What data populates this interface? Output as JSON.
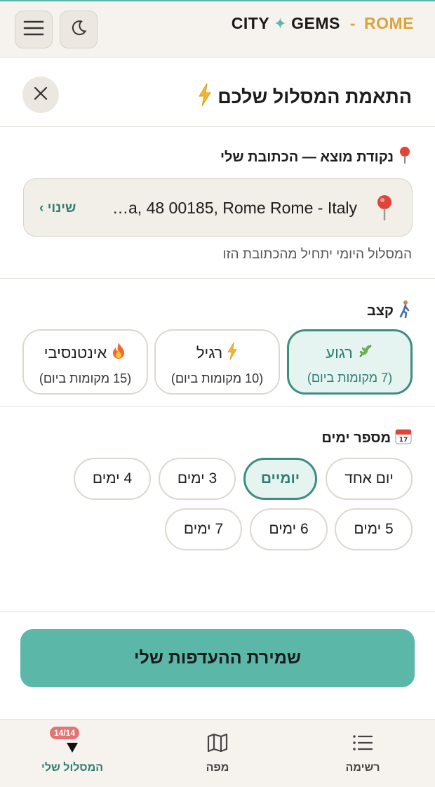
{
  "brand": {
    "part1": "CITY",
    "part2": "GEMS",
    "dash": "-",
    "city": "ROME"
  },
  "header": {
    "title": "התאמת המסלול שלכם"
  },
  "origin": {
    "label": "נקודת מוצא — הכתובת שלי",
    "address": "…a, 48 00185, Rome Rome - Italy",
    "change": "שינוי ›",
    "hint": "המסלול היומי יתחיל מהכתובת הזו"
  },
  "pace": {
    "label": "קצב",
    "options": [
      {
        "title": "רגוע",
        "sub": "(7 מקומות ביום)",
        "selected": true
      },
      {
        "title": "רגיל",
        "sub": "(10 מקומות ביום)",
        "selected": false
      },
      {
        "title": "אינטנסיבי",
        "sub": "(15 מקומות ביום)",
        "selected": false
      }
    ]
  },
  "days": {
    "label": "מספר ימים",
    "options": [
      "יום אחד",
      "יומיים",
      "3 ימים",
      "4 ימים",
      "5 ימים",
      "6 ימים",
      "7 ימים"
    ],
    "selected": "יומיים"
  },
  "save_button": "שמירת ההעדפות שלי",
  "bottom_nav": {
    "items": [
      {
        "label": "רשימה",
        "icon": "list-icon"
      },
      {
        "label": "מפה",
        "icon": "map-icon"
      },
      {
        "label": "המסלול שלי",
        "icon": "route-icon",
        "badge": "14/14",
        "active": true
      }
    ]
  },
  "colors": {
    "accent": "#5bb8a8",
    "accent_dark": "#2f7d72",
    "gold": "#d9a43a",
    "badge": "#e57373"
  }
}
